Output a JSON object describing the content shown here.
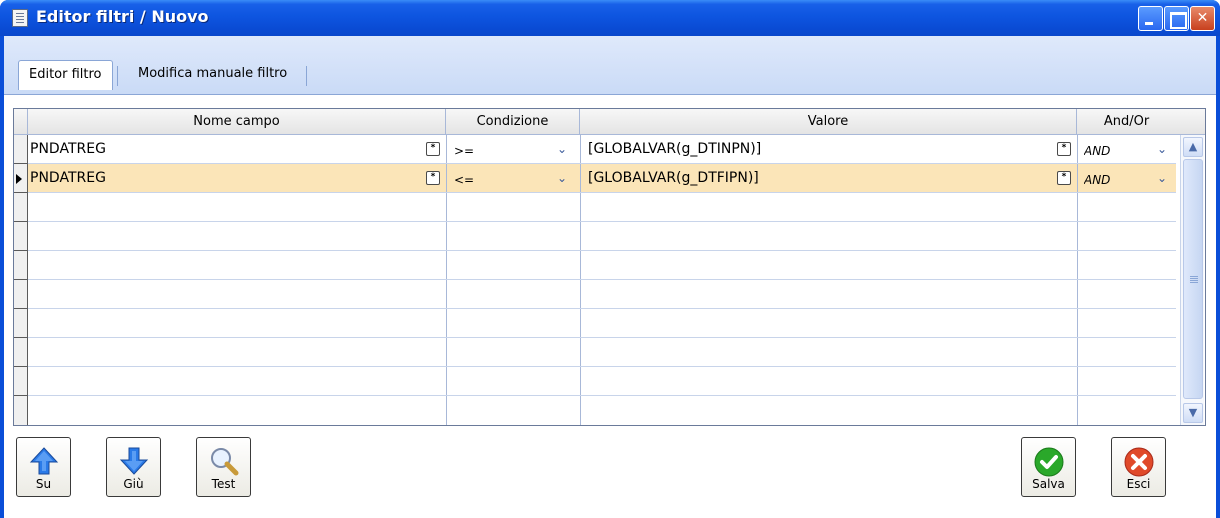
{
  "window": {
    "title": "Editor filtri / Nuovo",
    "controls": {
      "minimize": "",
      "maximize": "",
      "close": "✕"
    }
  },
  "tabs": [
    {
      "label": "Editor filtro",
      "active": true
    },
    {
      "label": "Modifica manuale filtro",
      "active": false
    }
  ],
  "grid": {
    "columns": [
      "Nome campo",
      "Condizione",
      "Valore",
      "And/Or"
    ],
    "rows": [
      {
        "field": "PNDATREG",
        "condition": ">=",
        "value": "[GLOBALVAR(g_DTINPN)]",
        "andor": "AND",
        "selected": false
      },
      {
        "field": "PNDATREG",
        "condition": "<=",
        "value": "[GLOBALVAR(g_DTFIPN)]",
        "andor": "AND",
        "selected": true
      }
    ],
    "empty_rows": 8
  },
  "buttons": {
    "su": "Su",
    "giu": "Giù",
    "test": "Test",
    "salva": "Salva",
    "esci": "Esci"
  },
  "colors": {
    "titlebar": "#0a4ed8",
    "selected_row": "#fbe5b8",
    "grid_line": "#a8b8d8",
    "arrow_blue": "#2a7ae8",
    "salva_green": "#2aa82a",
    "esci_red": "#d83a2a"
  },
  "icons": {
    "field_picker": "ellipsis-icon",
    "dropdown": "chevron-down-icon",
    "su": "arrow-up-icon",
    "giu": "arrow-down-icon",
    "test": "magnifier-icon",
    "salva": "check-icon",
    "esci": "close-icon"
  }
}
